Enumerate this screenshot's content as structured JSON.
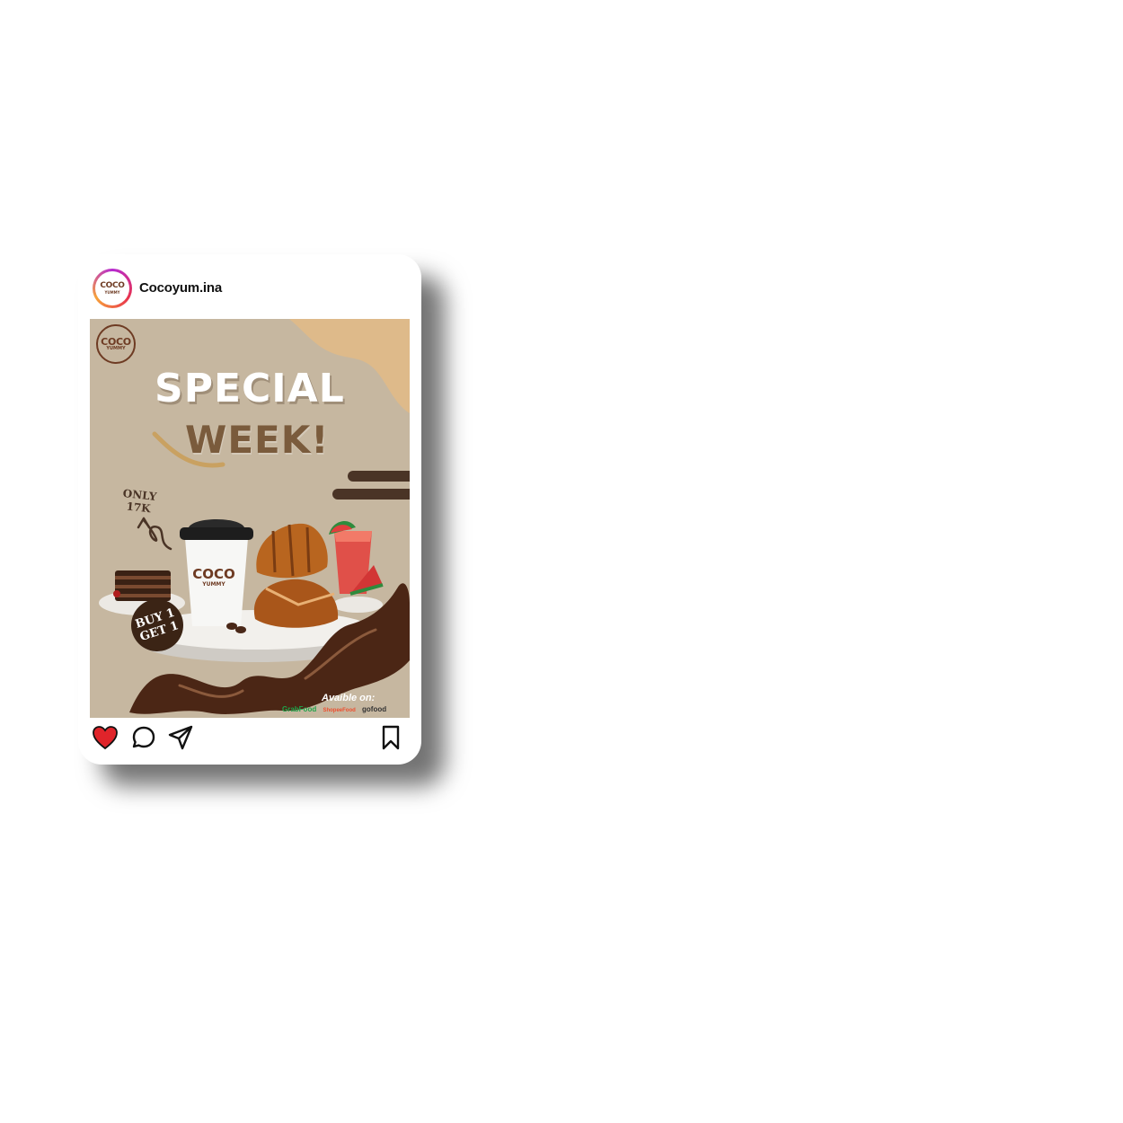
{
  "profile": {
    "username": "Cocoyum.ina",
    "avatar_logo_main": "COCO",
    "avatar_logo_sub": "YUMMY"
  },
  "post": {
    "logo_main": "COCO",
    "logo_sub": "YUMMY",
    "headline_1": "SPECIAL",
    "headline_2": "WEEK!",
    "price_line_1": "ONLY",
    "price_line_2": "17K",
    "promo_line_1": "BUY 1",
    "promo_line_2": "GET 1",
    "cup_brand_main": "COCO",
    "cup_brand_sub": "YUMMY",
    "available_label": "Avaible on:",
    "platforms": [
      "GrabFood",
      "ShopeeFood",
      "gofood"
    ],
    "colors": {
      "background": "#c6b7a0",
      "accent_shape": "#deba8a",
      "brown": "#6e3b23",
      "headline_brown": "#7a5b3c"
    }
  },
  "actions": {
    "like": "heart-icon",
    "comment": "comment-icon",
    "share": "send-icon",
    "save": "bookmark-icon",
    "like_color": "#e0242a"
  }
}
